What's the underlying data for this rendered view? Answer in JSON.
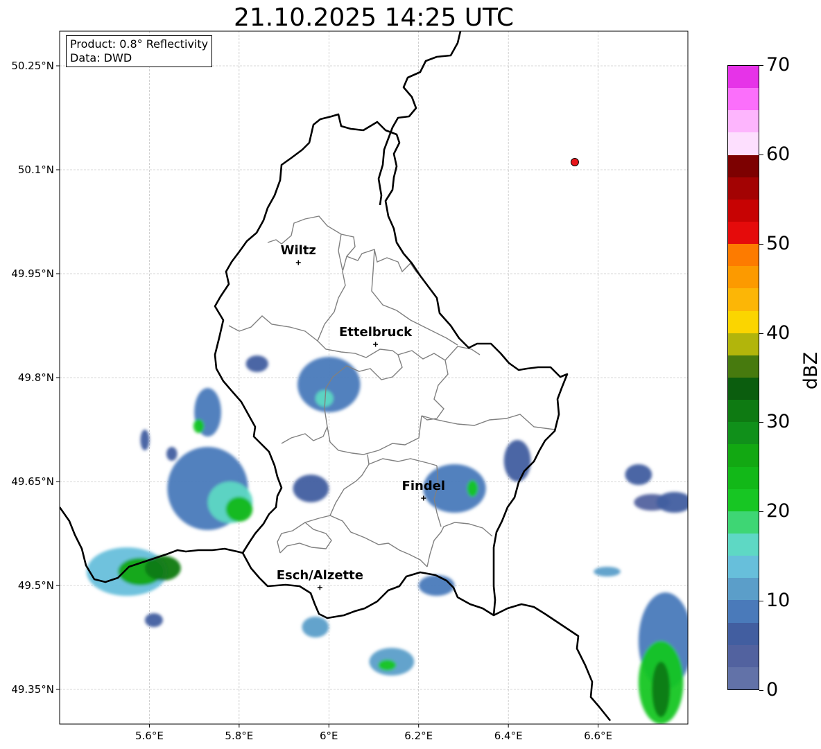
{
  "title": "21.10.2025 14:25 UTC",
  "info": {
    "product": "Product: 0.8° Reflectivity",
    "source": "Data: DWD"
  },
  "lat_labels": [
    "50.25°N",
    "50.1°N",
    "49.95°N",
    "49.8°N",
    "49.65°N",
    "49.5°N",
    "49.35°N"
  ],
  "lat_values": [
    50.25,
    50.1,
    49.95,
    49.8,
    49.65,
    49.5,
    49.35
  ],
  "lon_labels": [
    "5.6°E",
    "5.8°E",
    "6°E",
    "6.2°E",
    "6.4°E",
    "6.6°E"
  ],
  "lon_values": [
    5.6,
    5.8,
    6.0,
    6.2,
    6.4,
    6.6
  ],
  "extent": {
    "lon_min": 5.4,
    "lon_max": 6.8,
    "lat_min": 49.3,
    "lat_max": 50.3
  },
  "cities": [
    {
      "name": "Wiltz",
      "lon": 5.932,
      "lat": 49.966
    },
    {
      "name": "Ettelbruck",
      "lon": 6.104,
      "lat": 49.848
    },
    {
      "name": "Findel",
      "lon": 6.211,
      "lat": 49.626
    },
    {
      "name": "Esch/Alzette",
      "lon": 5.98,
      "lat": 49.497
    }
  ],
  "radar_site_marker": {
    "lon": 6.548,
    "lat": 50.111,
    "color": "#e8161b"
  },
  "colorbar": {
    "label": "dBZ",
    "ticks": [
      "0",
      "10",
      "20",
      "30",
      "40",
      "50",
      "60",
      "70"
    ],
    "tick_values": [
      0,
      10,
      20,
      30,
      40,
      50,
      60,
      70
    ],
    "min": 0,
    "max": 70,
    "step": 2.5,
    "colors": [
      "#6272a8",
      "#52629f",
      "#425ea0",
      "#4a7aba",
      "#5b9ec9",
      "#67bfdb",
      "#5ed8c4",
      "#3ed674",
      "#17c623",
      "#12b818",
      "#12a812",
      "#10901a",
      "#0e7a12",
      "#0b5d0e",
      "#477a0e",
      "#b2b50b",
      "#fbd500",
      "#fcb606",
      "#fc9a00",
      "#fd7b00",
      "#e50b0b",
      "#c70303",
      "#a30303",
      "#7d0101",
      "#fddffe",
      "#fdb5fd",
      "#fb6ffb",
      "#e633e8"
    ]
  },
  "colors": {
    "border": "#000000",
    "cantons": "#808080",
    "grid": "#b0b0b0"
  },
  "precip_cells": [
    {
      "lon": 5.55,
      "lat": 49.52,
      "rx": 0.09,
      "ry": 0.035,
      "dbz": 14
    },
    {
      "lon": 5.58,
      "lat": 49.52,
      "rx": 0.05,
      "ry": 0.02,
      "dbz": 26
    },
    {
      "lon": 5.63,
      "lat": 49.525,
      "rx": 0.04,
      "ry": 0.018,
      "dbz": 31
    },
    {
      "lon": 5.73,
      "lat": 49.64,
      "rx": 0.09,
      "ry": 0.06,
      "dbz": 8
    },
    {
      "lon": 5.78,
      "lat": 49.62,
      "rx": 0.05,
      "ry": 0.03,
      "dbz": 17
    },
    {
      "lon": 5.8,
      "lat": 49.61,
      "rx": 0.03,
      "ry": 0.018,
      "dbz": 23
    },
    {
      "lon": 5.73,
      "lat": 49.75,
      "rx": 0.03,
      "ry": 0.035,
      "dbz": 9
    },
    {
      "lon": 5.71,
      "lat": 49.73,
      "rx": 0.012,
      "ry": 0.01,
      "dbz": 22
    },
    {
      "lon": 5.96,
      "lat": 49.64,
      "rx": 0.04,
      "ry": 0.02,
      "dbz": 7
    },
    {
      "lon": 6.0,
      "lat": 49.79,
      "rx": 0.07,
      "ry": 0.04,
      "dbz": 8
    },
    {
      "lon": 5.99,
      "lat": 49.77,
      "rx": 0.02,
      "ry": 0.012,
      "dbz": 15
    },
    {
      "lon": 5.84,
      "lat": 49.82,
      "rx": 0.025,
      "ry": 0.012,
      "dbz": 7
    },
    {
      "lon": 6.28,
      "lat": 49.64,
      "rx": 0.07,
      "ry": 0.035,
      "dbz": 9
    },
    {
      "lon": 6.32,
      "lat": 49.64,
      "rx": 0.012,
      "ry": 0.012,
      "dbz": 22
    },
    {
      "lon": 6.42,
      "lat": 49.68,
      "rx": 0.03,
      "ry": 0.03,
      "dbz": 7
    },
    {
      "lon": 6.24,
      "lat": 49.5,
      "rx": 0.04,
      "ry": 0.015,
      "dbz": 8
    },
    {
      "lon": 5.97,
      "lat": 49.44,
      "rx": 0.03,
      "ry": 0.015,
      "dbz": 10
    },
    {
      "lon": 6.14,
      "lat": 49.39,
      "rx": 0.05,
      "ry": 0.02,
      "dbz": 12
    },
    {
      "lon": 6.13,
      "lat": 49.385,
      "rx": 0.02,
      "ry": 0.008,
      "dbz": 21
    },
    {
      "lon": 6.62,
      "lat": 49.52,
      "rx": 0.03,
      "ry": 0.007,
      "dbz": 12
    },
    {
      "lon": 6.69,
      "lat": 49.66,
      "rx": 0.03,
      "ry": 0.015,
      "dbz": 5
    },
    {
      "lon": 6.72,
      "lat": 49.62,
      "rx": 0.04,
      "ry": 0.012,
      "dbz": 4
    },
    {
      "lon": 6.77,
      "lat": 49.62,
      "rx": 0.04,
      "ry": 0.015,
      "dbz": 6
    },
    {
      "lon": 6.75,
      "lat": 49.42,
      "rx": 0.06,
      "ry": 0.07,
      "dbz": 8
    },
    {
      "lon": 6.74,
      "lat": 49.36,
      "rx": 0.05,
      "ry": 0.06,
      "dbz": 22
    },
    {
      "lon": 6.74,
      "lat": 49.35,
      "rx": 0.02,
      "ry": 0.04,
      "dbz": 31
    },
    {
      "lon": 5.65,
      "lat": 49.69,
      "rx": 0.012,
      "ry": 0.01,
      "dbz": 7
    },
    {
      "lon": 5.59,
      "lat": 49.71,
      "rx": 0.01,
      "ry": 0.015,
      "dbz": 7
    },
    {
      "lon": 5.61,
      "lat": 49.45,
      "rx": 0.02,
      "ry": 0.01,
      "dbz": 6
    }
  ]
}
